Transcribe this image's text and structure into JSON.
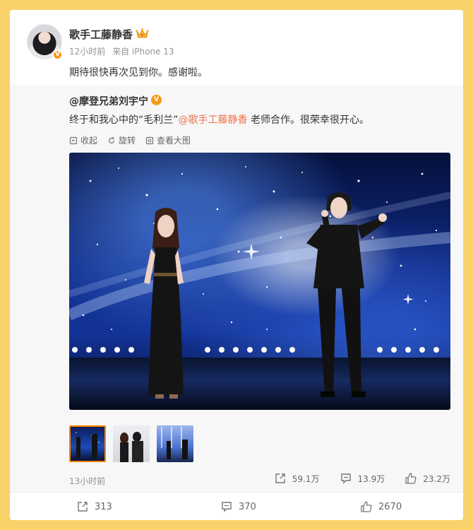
{
  "post": {
    "username": "歌手工藤静香",
    "verified_badge": "V",
    "time": "12小时前",
    "source": "来自 iPhone 13",
    "text": "期待很快再次见到你。感谢啦。"
  },
  "repost": {
    "username": "@摩登兄弟刘宇宁",
    "verified_badge": "V",
    "text_before": "终于和我心中的“毛利兰”",
    "mention": "@歌手工藤静香",
    "text_after": " 老师合作。很荣幸很开心。",
    "actions": {
      "collect": "收起",
      "rotate": "旋转",
      "view_large": "查看大图"
    },
    "time": "13小时前",
    "stats": {
      "reposts": "59.1万",
      "comments": "13.9万",
      "likes": "23.2万"
    }
  },
  "footer": {
    "reposts": "313",
    "comments": "370",
    "likes": "2670"
  },
  "colors": {
    "background": "#f9d36a",
    "mention": "#eb7350",
    "verified": "#f59b1c",
    "active_thumb": "#ff8200"
  }
}
